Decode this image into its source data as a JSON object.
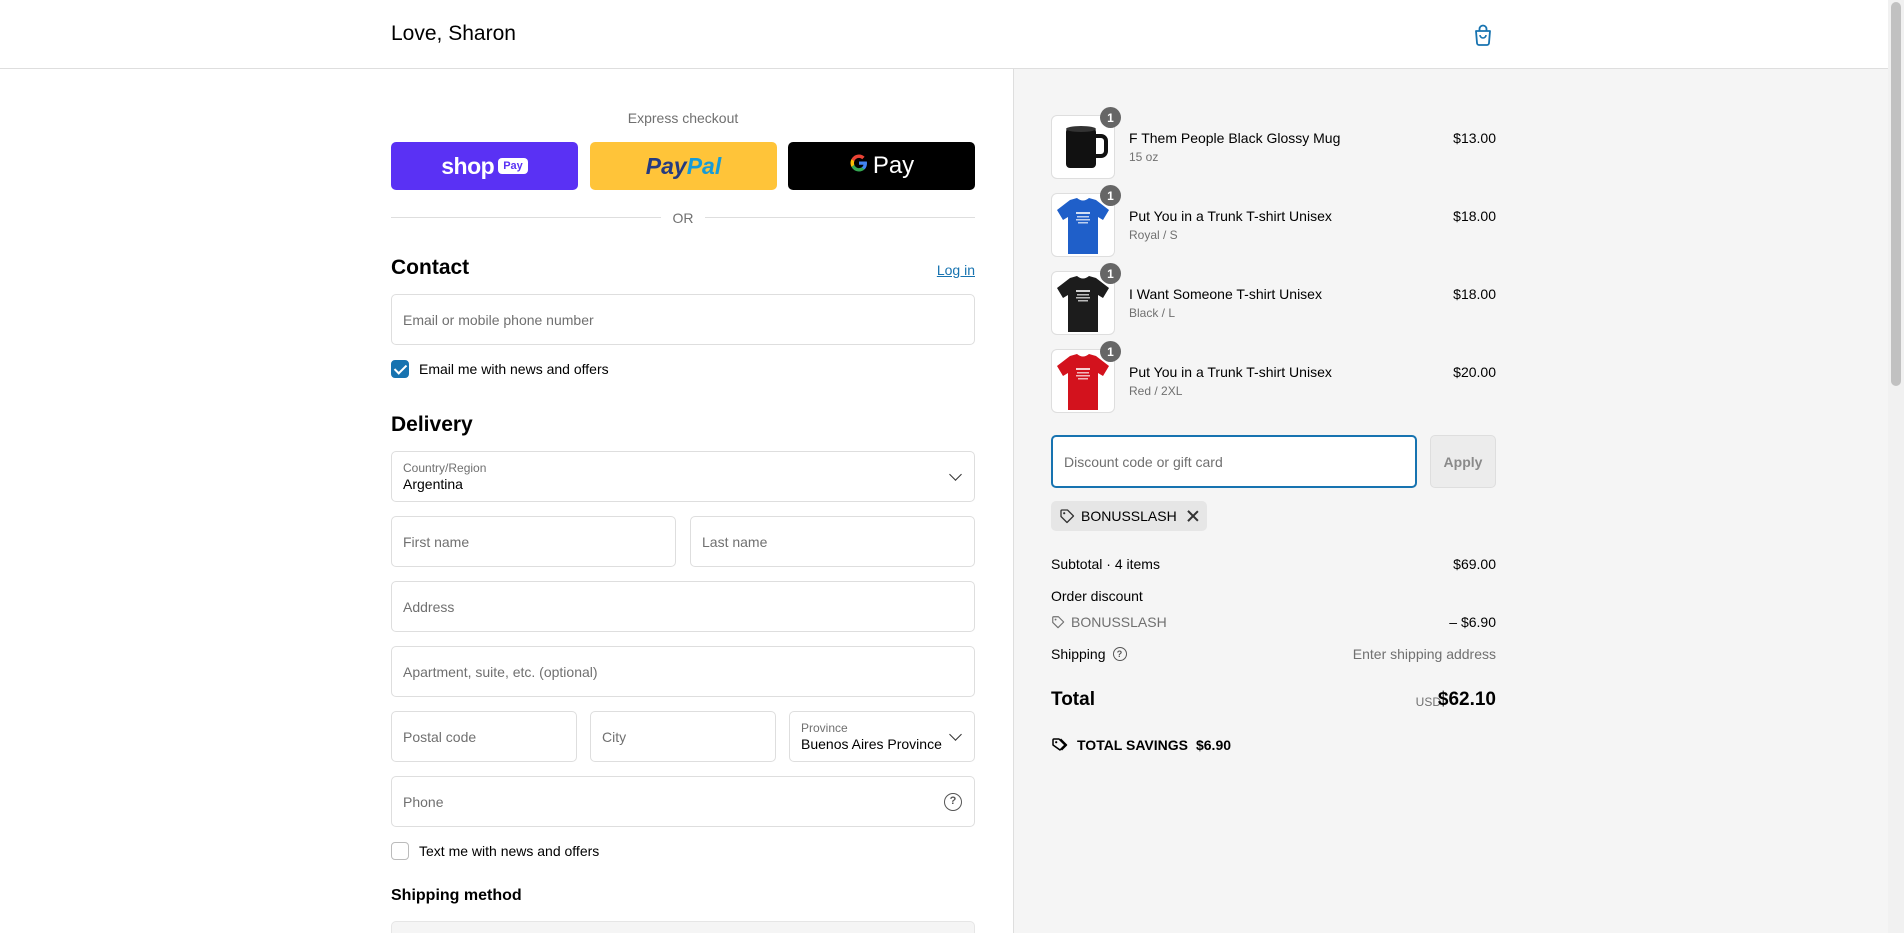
{
  "header": {
    "brand": "Love, Sharon",
    "cart_icon": "shopping-bag-icon"
  },
  "express": {
    "label": "Express checkout",
    "shop_pay": {
      "logo": "shop",
      "pill": "Pay"
    },
    "paypal": {
      "part1": "Pay",
      "part2": "Pal"
    },
    "gpay": {
      "g": "G",
      "text": "Pay"
    },
    "or": "OR"
  },
  "contact": {
    "title": "Contact",
    "login": "Log in",
    "email_placeholder": "Email or mobile phone number",
    "news_checkbox": "Email me with news and offers",
    "news_checked": true
  },
  "delivery": {
    "title": "Delivery",
    "country_label": "Country/Region",
    "country_value": "Argentina",
    "first_name": "First name",
    "last_name": "Last name",
    "address": "Address",
    "apartment": "Apartment, suite, etc. (optional)",
    "postal": "Postal code",
    "city": "City",
    "province_label": "Province",
    "province_value": "Buenos Aires Province",
    "phone": "Phone",
    "text_checkbox": "Text me with news and offers",
    "shipping_method": "Shipping method"
  },
  "summary": {
    "items": [
      {
        "name": "F Them People Black Glossy Mug",
        "variant": "15 oz",
        "price": "$13.00",
        "qty": "1",
        "color": "#111111",
        "kind": "mug"
      },
      {
        "name": "Put You in a Trunk T-shirt Unisex",
        "variant": "Royal / S",
        "price": "$18.00",
        "qty": "1",
        "color": "#1f5fc9",
        "kind": "shirt"
      },
      {
        "name": "I Want Someone T-shirt Unisex",
        "variant": "Black / L",
        "price": "$18.00",
        "qty": "1",
        "color": "#1c1c1c",
        "kind": "shirt"
      },
      {
        "name": "Put You in a Trunk T-shirt Unisex",
        "variant": "Red / 2XL",
        "price": "$20.00",
        "qty": "1",
        "color": "#d3121d",
        "kind": "shirt"
      }
    ],
    "discount_placeholder": "Discount code or gift card",
    "apply": "Apply",
    "applied_code": "BONUSSLASH",
    "subtotal_label": "Subtotal · 4 items",
    "subtotal_value": "$69.00",
    "order_discount_label": "Order discount",
    "discount_code": "BONUSSLASH",
    "discount_value": "– $6.90",
    "shipping_label": "Shipping",
    "shipping_value": "Enter shipping address",
    "total_label": "Total",
    "total_currency": "USD",
    "total_value": "$62.10",
    "savings_label": "TOTAL SAVINGS",
    "savings_value": "$6.90"
  },
  "colors": {
    "accent": "#1773b0",
    "shop_pay": "#5a31f4",
    "paypal": "#ffc439",
    "summary_bg": "#f5f5f5"
  }
}
